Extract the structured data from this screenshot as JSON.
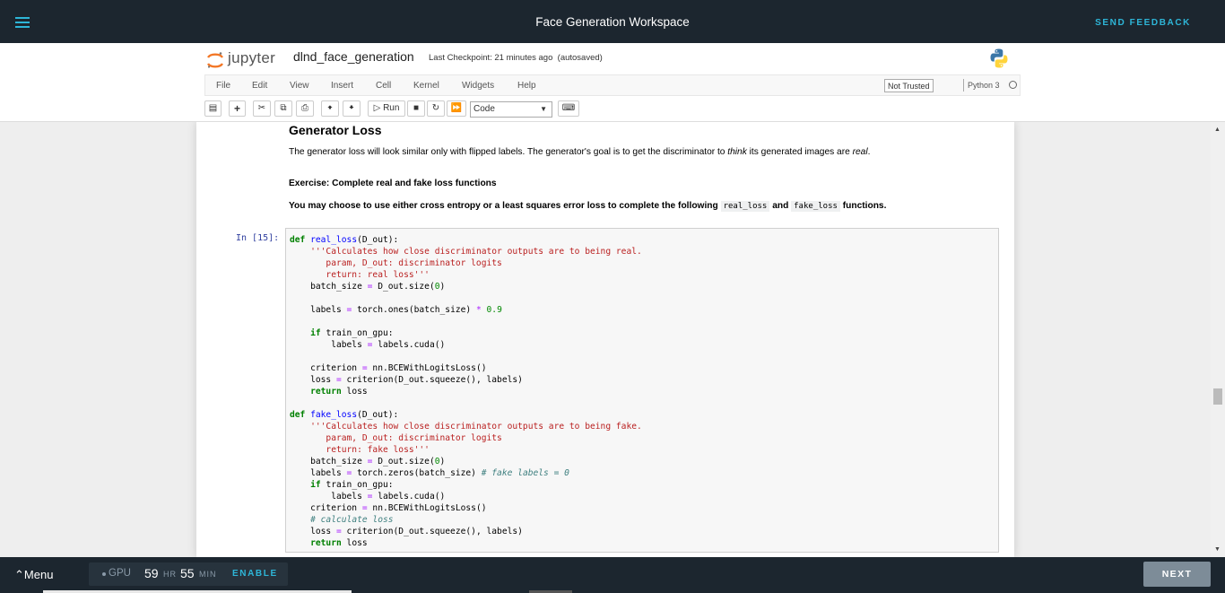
{
  "topbar": {
    "title": "Face Generation Workspace",
    "feedback_label": "SEND FEEDBACK",
    "accent_color": "#2eb6d8",
    "background_color": "#1c262f"
  },
  "jupyter": {
    "logo_text": "jupyter",
    "notebook_name": "dlnd_face_generation",
    "checkpoint": "Last Checkpoint: 21 minutes ago",
    "autosave": "(autosaved)",
    "menus": [
      "File",
      "Edit",
      "View",
      "Insert",
      "Cell",
      "Kernel",
      "Widgets",
      "Help"
    ],
    "trust_label": "Not Trusted",
    "kernel_name": "Python 3",
    "toolbar": {
      "run_label": "Run",
      "cell_type": "Code"
    }
  },
  "notebook": {
    "heading": "Generator Loss",
    "para1_a": "The generator loss will look similar only with flipped labels. The generator's goal is to get the discriminator to ",
    "para1_think": "think",
    "para1_b": " its generated images are ",
    "para1_real": "real",
    "para1_c": ".",
    "exercise": "Exercise: Complete real and fake loss functions",
    "para2_a": "You may choose to use either cross entropy or a least squares error loss to complete the following ",
    "para2_code1": "real_loss",
    "para2_and": " and ",
    "para2_code2": "fake_loss",
    "para2_b": " functions.",
    "prompt": "In [15]:"
  },
  "bottombar": {
    "menu_label": "Menu",
    "gpu_label": "GPU",
    "hours": "59",
    "hours_unit": "HR",
    "minutes": "55",
    "minutes_unit": "MIN",
    "enable_label": "ENABLE",
    "next_label": "NEXT"
  }
}
